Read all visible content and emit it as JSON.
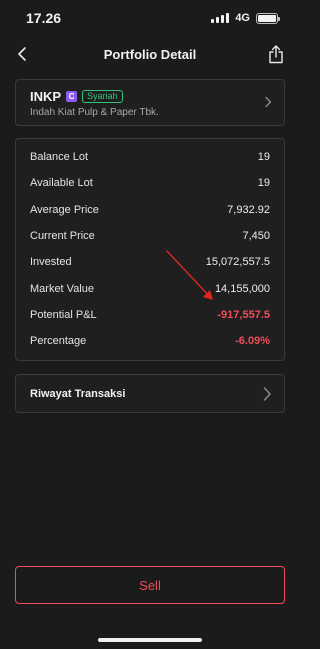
{
  "status_bar": {
    "time": "17.26",
    "network": "4G"
  },
  "nav": {
    "title": "Portfolio Detail",
    "back_icon": "chevron-left-icon",
    "share_icon": "share-icon"
  },
  "stock": {
    "ticker": "INKP",
    "syariah_icon_label": "C",
    "syariah_badge": "Syariah",
    "company": "Indah Kiat Pulp & Paper Tbk."
  },
  "details": [
    {
      "label": "Balance Lot",
      "value": "19",
      "negative": false
    },
    {
      "label": "Available Lot",
      "value": "19",
      "negative": false
    },
    {
      "label": "Average Price",
      "value": "7,932.92",
      "negative": false
    },
    {
      "label": "Current Price",
      "value": "7,450",
      "negative": false
    },
    {
      "label": "Invested",
      "value": "15,072,557.5",
      "negative": false
    },
    {
      "label": "Market Value",
      "value": "14,155,000",
      "negative": false
    },
    {
      "label": "Potential P&L",
      "value": "-917,557.5",
      "negative": true
    },
    {
      "label": "Percentage",
      "value": "-6.09%",
      "negative": true
    }
  ],
  "history": {
    "label": "Riwayat Transaksi"
  },
  "sell": {
    "label": "Sell"
  },
  "colors": {
    "background": "#1b1b1b",
    "negative": "#ef4d5a",
    "syariah_green": "#36c17a",
    "syariah_purple": "#8a5cf0",
    "annotation_arrow": "#e02424"
  }
}
